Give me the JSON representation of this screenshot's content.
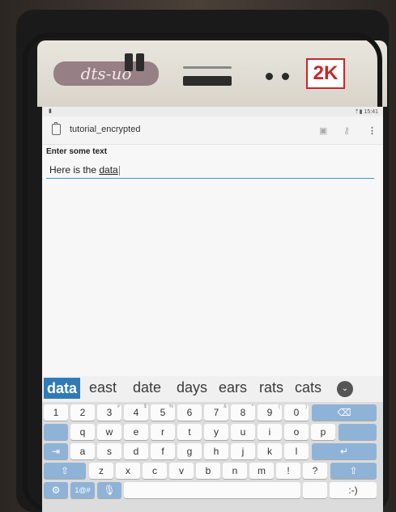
{
  "sticker": {
    "logo_text": "dts-uo",
    "k_text": "2K"
  },
  "status": {
    "time": "15:41",
    "icons": "⇡▮"
  },
  "app": {
    "title": "tutorial_encrypted",
    "action_icons": [
      "save-icon",
      "key-icon",
      "overflow-menu-icon"
    ]
  },
  "form": {
    "label": "Enter some text",
    "value_prefix": "Here is the ",
    "value_word": "data"
  },
  "suggestions": [
    "data",
    "east",
    "date",
    "days",
    "ears",
    "rats",
    "cats"
  ],
  "keyboard": {
    "row1": [
      [
        "1",
        ""
      ],
      [
        "2",
        ""
      ],
      [
        "3",
        "#"
      ],
      [
        "4",
        "$"
      ],
      [
        "5",
        "%"
      ],
      [
        "6",
        ""
      ],
      [
        "7",
        "&"
      ],
      [
        "8",
        "*"
      ],
      [
        "9",
        "("
      ],
      [
        "0",
        ")"
      ]
    ],
    "row2": [
      [
        "q",
        ""
      ],
      [
        "w",
        ""
      ],
      [
        "e",
        ""
      ],
      [
        "r",
        ""
      ],
      [
        "t",
        ""
      ],
      [
        "y",
        ""
      ],
      [
        "u",
        ""
      ],
      [
        "i",
        ""
      ],
      [
        "o",
        ""
      ],
      [
        "p",
        ""
      ]
    ],
    "row3": [
      [
        "a",
        ""
      ],
      [
        "s",
        ""
      ],
      [
        "d",
        ""
      ],
      [
        "f",
        ""
      ],
      [
        "g",
        ""
      ],
      [
        "h",
        ""
      ],
      [
        "j",
        ""
      ],
      [
        "k",
        ""
      ],
      [
        "l",
        ""
      ]
    ],
    "row4": [
      [
        "z",
        ""
      ],
      [
        "x",
        ""
      ],
      [
        "c",
        ""
      ],
      [
        "v",
        ""
      ],
      [
        "b",
        ""
      ],
      [
        "n",
        ""
      ],
      [
        "m",
        ""
      ],
      [
        "!",
        ""
      ],
      [
        "?",
        ""
      ]
    ],
    "symbols_label": "1@#",
    "smiley": ":-)",
    "shift_glyph": "⇧",
    "backspace_glyph": "⌫",
    "enter_glyph": "↵",
    "tab_glyph": "⇥",
    "settings_glyph": "⚙",
    "mic_glyph": "🎙"
  },
  "colors": {
    "accent": "#3a9ad9",
    "suggestion_active": "#2f7bb8",
    "fn_key": "#8fb3d6"
  }
}
